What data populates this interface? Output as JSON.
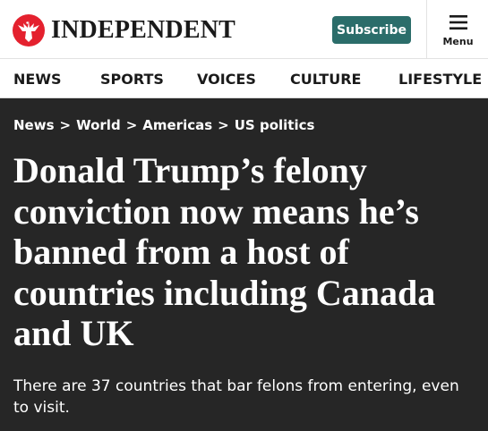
{
  "header": {
    "logo_text": "INDEPENDENT",
    "subscribe_label": "Subscribe",
    "menu_label": "Menu"
  },
  "nav": {
    "items": [
      "NEWS",
      "SPORTS",
      "VOICES",
      "CULTURE",
      "LIFESTYLE"
    ]
  },
  "breadcrumb": [
    "News",
    "World",
    "Americas",
    "US politics"
  ],
  "breadcrumb_separator": ">",
  "article": {
    "headline_lines": [
      "Donald Trump’s felony",
      "conviction now means he’s",
      "banned from a host of",
      "countries including Canada",
      "and UK"
    ],
    "standfirst": "There are 37 countries that bar felons from entering, even to visit."
  },
  "colors": {
    "brand_red": "#e4212e",
    "subscribe_bg": "#2b6d6a",
    "article_bg": "#262626"
  },
  "icons": {
    "logo": "eagle-logo-icon",
    "menu": "hamburger-menu-icon"
  }
}
